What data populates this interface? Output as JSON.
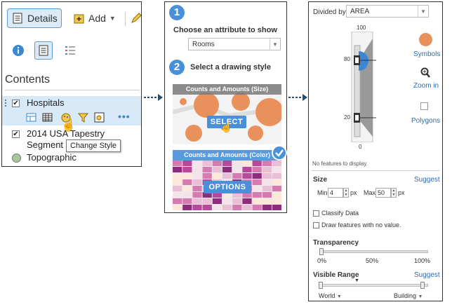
{
  "panel1": {
    "details_label": "Details",
    "add_label": "Add",
    "contents_title": "Contents",
    "layers": [
      {
        "name": "Hospitals",
        "checked": true
      },
      {
        "name": "2014 USA Tapestry",
        "name2": "Segment",
        "checked": true
      },
      {
        "name": "Topographic"
      }
    ],
    "tooltip": "Change Style"
  },
  "panel2": {
    "step1_num": "1",
    "step1_title": "Choose an attribute to show",
    "attribute_value": "Rooms",
    "step2_num": "2",
    "step2_title": "Select a drawing style",
    "card1_title": "Counts and Amounts (Size)",
    "card1_button": "SELECT",
    "card2_title": "Counts and Amounts (Color)",
    "card2_button": "OPTIONS"
  },
  "panel3": {
    "divided_by_label": "Divided by",
    "divided_by_value": "AREA",
    "axis_top": "100",
    "axis_80": "80",
    "axis_20": "20",
    "axis_bottom": "0",
    "symbols_label": "Symbols",
    "zoom_label": "Zoom in",
    "polygons_label": "Polygons",
    "no_features": "No features to display.",
    "size_label": "Size",
    "suggest_label": "Suggest",
    "min_label": "Min",
    "min_value": "4",
    "max_label": "Max",
    "max_value": "50",
    "px_unit": "px",
    "classify_label": "Classify Data",
    "draw_no_value_label": "Draw features with no value.",
    "transparency_label": "Transparency",
    "t0": "0%",
    "t50": "50%",
    "t100": "100%",
    "transparency_value": 0,
    "visible_range_label": "Visible Range",
    "suggest2_label": "Suggest",
    "range_min": "World",
    "range_max": "Building",
    "accent": "#e8915a"
  }
}
